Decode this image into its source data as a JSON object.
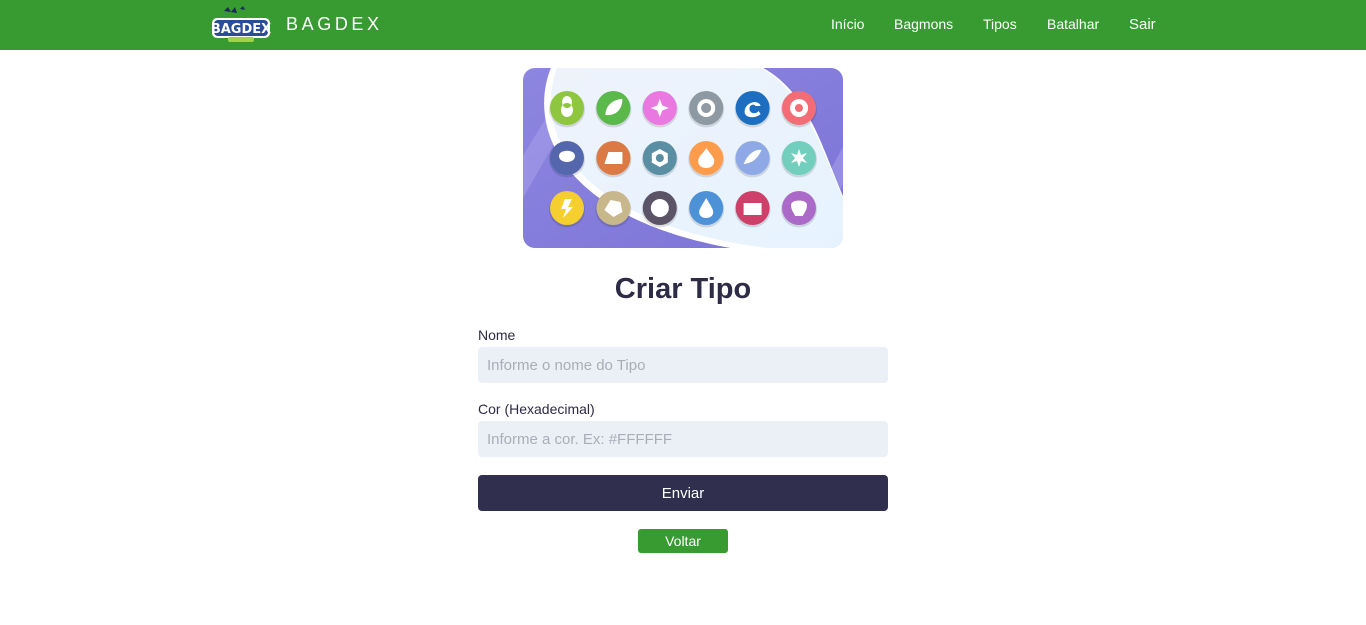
{
  "navbar": {
    "logo_text": "BAGDEX",
    "brand": "BAGDEX",
    "links": [
      "Início",
      "Bagmons",
      "Tipos",
      "Batalhar",
      "Sair"
    ]
  },
  "banner": {
    "icons": [
      {
        "name": "bug-type-icon",
        "color": "#8ec63f"
      },
      {
        "name": "grass-type-icon",
        "color": "#5bb84a"
      },
      {
        "name": "fairy-type-icon",
        "color": "#e979e0"
      },
      {
        "name": "normal-type-icon",
        "color": "#8e9aa3"
      },
      {
        "name": "dragon-type-icon",
        "color": "#1d6ec0"
      },
      {
        "name": "psychic-type-icon",
        "color": "#f46c75"
      },
      {
        "name": "ghost-type-icon",
        "color": "#5567ac"
      },
      {
        "name": "ground-type-icon",
        "color": "#db7a45"
      },
      {
        "name": "steel-type-icon",
        "color": "#5a8fa3"
      },
      {
        "name": "fire-type-icon",
        "color": "#fd9c4c"
      },
      {
        "name": "flying-type-icon",
        "color": "#8fa9e6"
      },
      {
        "name": "ice-type-icon",
        "color": "#72cfbd"
      },
      {
        "name": "electric-type-icon",
        "color": "#f5cf2f"
      },
      {
        "name": "rock-type-icon",
        "color": "#c7b78b"
      },
      {
        "name": "dark-type-icon",
        "color": "#5a5466"
      },
      {
        "name": "water-type-icon",
        "color": "#4d91d6"
      },
      {
        "name": "fighting-type-icon",
        "color": "#ce4069"
      },
      {
        "name": "poison-type-icon",
        "color": "#ab6ac8"
      }
    ]
  },
  "page": {
    "title": "Criar Tipo"
  },
  "form": {
    "name_label": "Nome",
    "name_placeholder": "Informe o nome do Tipo",
    "name_value": "",
    "color_label": "Cor (Hexadecimal)",
    "color_placeholder": "Informe a cor. Ex: #FFFFFF",
    "color_value": "",
    "submit_label": "Enviar",
    "back_label": "Voltar"
  },
  "colors": {
    "nav_green": "#379b32",
    "dark_button": "#302f4d",
    "input_bg": "#ebf0f7",
    "text_dark": "#2d2b45"
  }
}
